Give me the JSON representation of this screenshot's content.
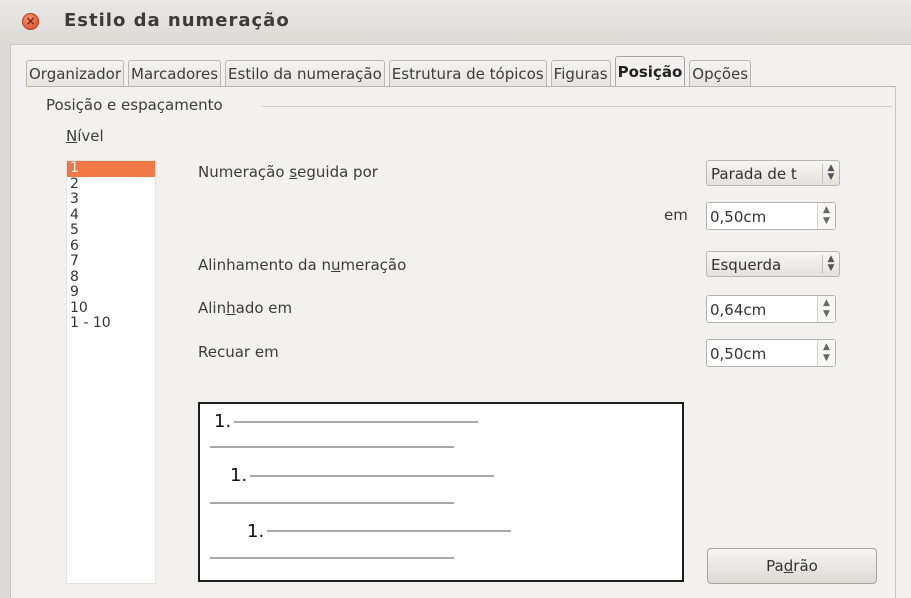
{
  "window": {
    "title": "Estilo da numeração"
  },
  "tabs": [
    {
      "label": "Organizador",
      "active": false
    },
    {
      "label": "Marcadores",
      "active": false
    },
    {
      "label": "Estilo da numeração",
      "active": false
    },
    {
      "label": "Estrutura de tópicos",
      "active": false
    },
    {
      "label": "Figuras",
      "active": false
    },
    {
      "label": "Posição",
      "active": true
    },
    {
      "label": "Opções",
      "active": false
    }
  ],
  "section": {
    "title": "Posição e espaçamento"
  },
  "levels": {
    "label": "Nível",
    "items": [
      "1",
      "2",
      "3",
      "4",
      "5",
      "6",
      "7",
      "8",
      "9",
      "10",
      "1 - 10"
    ],
    "selected": "1"
  },
  "fields": {
    "numbering_followed_by": {
      "label": "Numeração seguida por",
      "value": "Parada de t"
    },
    "at": {
      "label": "em",
      "value": "0,50cm"
    },
    "numbering_alignment": {
      "label": "Alinhamento da numeração",
      "value": "Esquerda"
    },
    "aligned_at": {
      "label": "Alinhado em",
      "value": "0,64cm"
    },
    "indent_at": {
      "label": "Recuar em",
      "value": "0,50cm"
    }
  },
  "preview": {
    "numbers": [
      "1.",
      "1.",
      "1."
    ]
  },
  "buttons": {
    "default": "Padrão"
  },
  "colors": {
    "selection": "#f07746",
    "close": "#e0552f"
  }
}
